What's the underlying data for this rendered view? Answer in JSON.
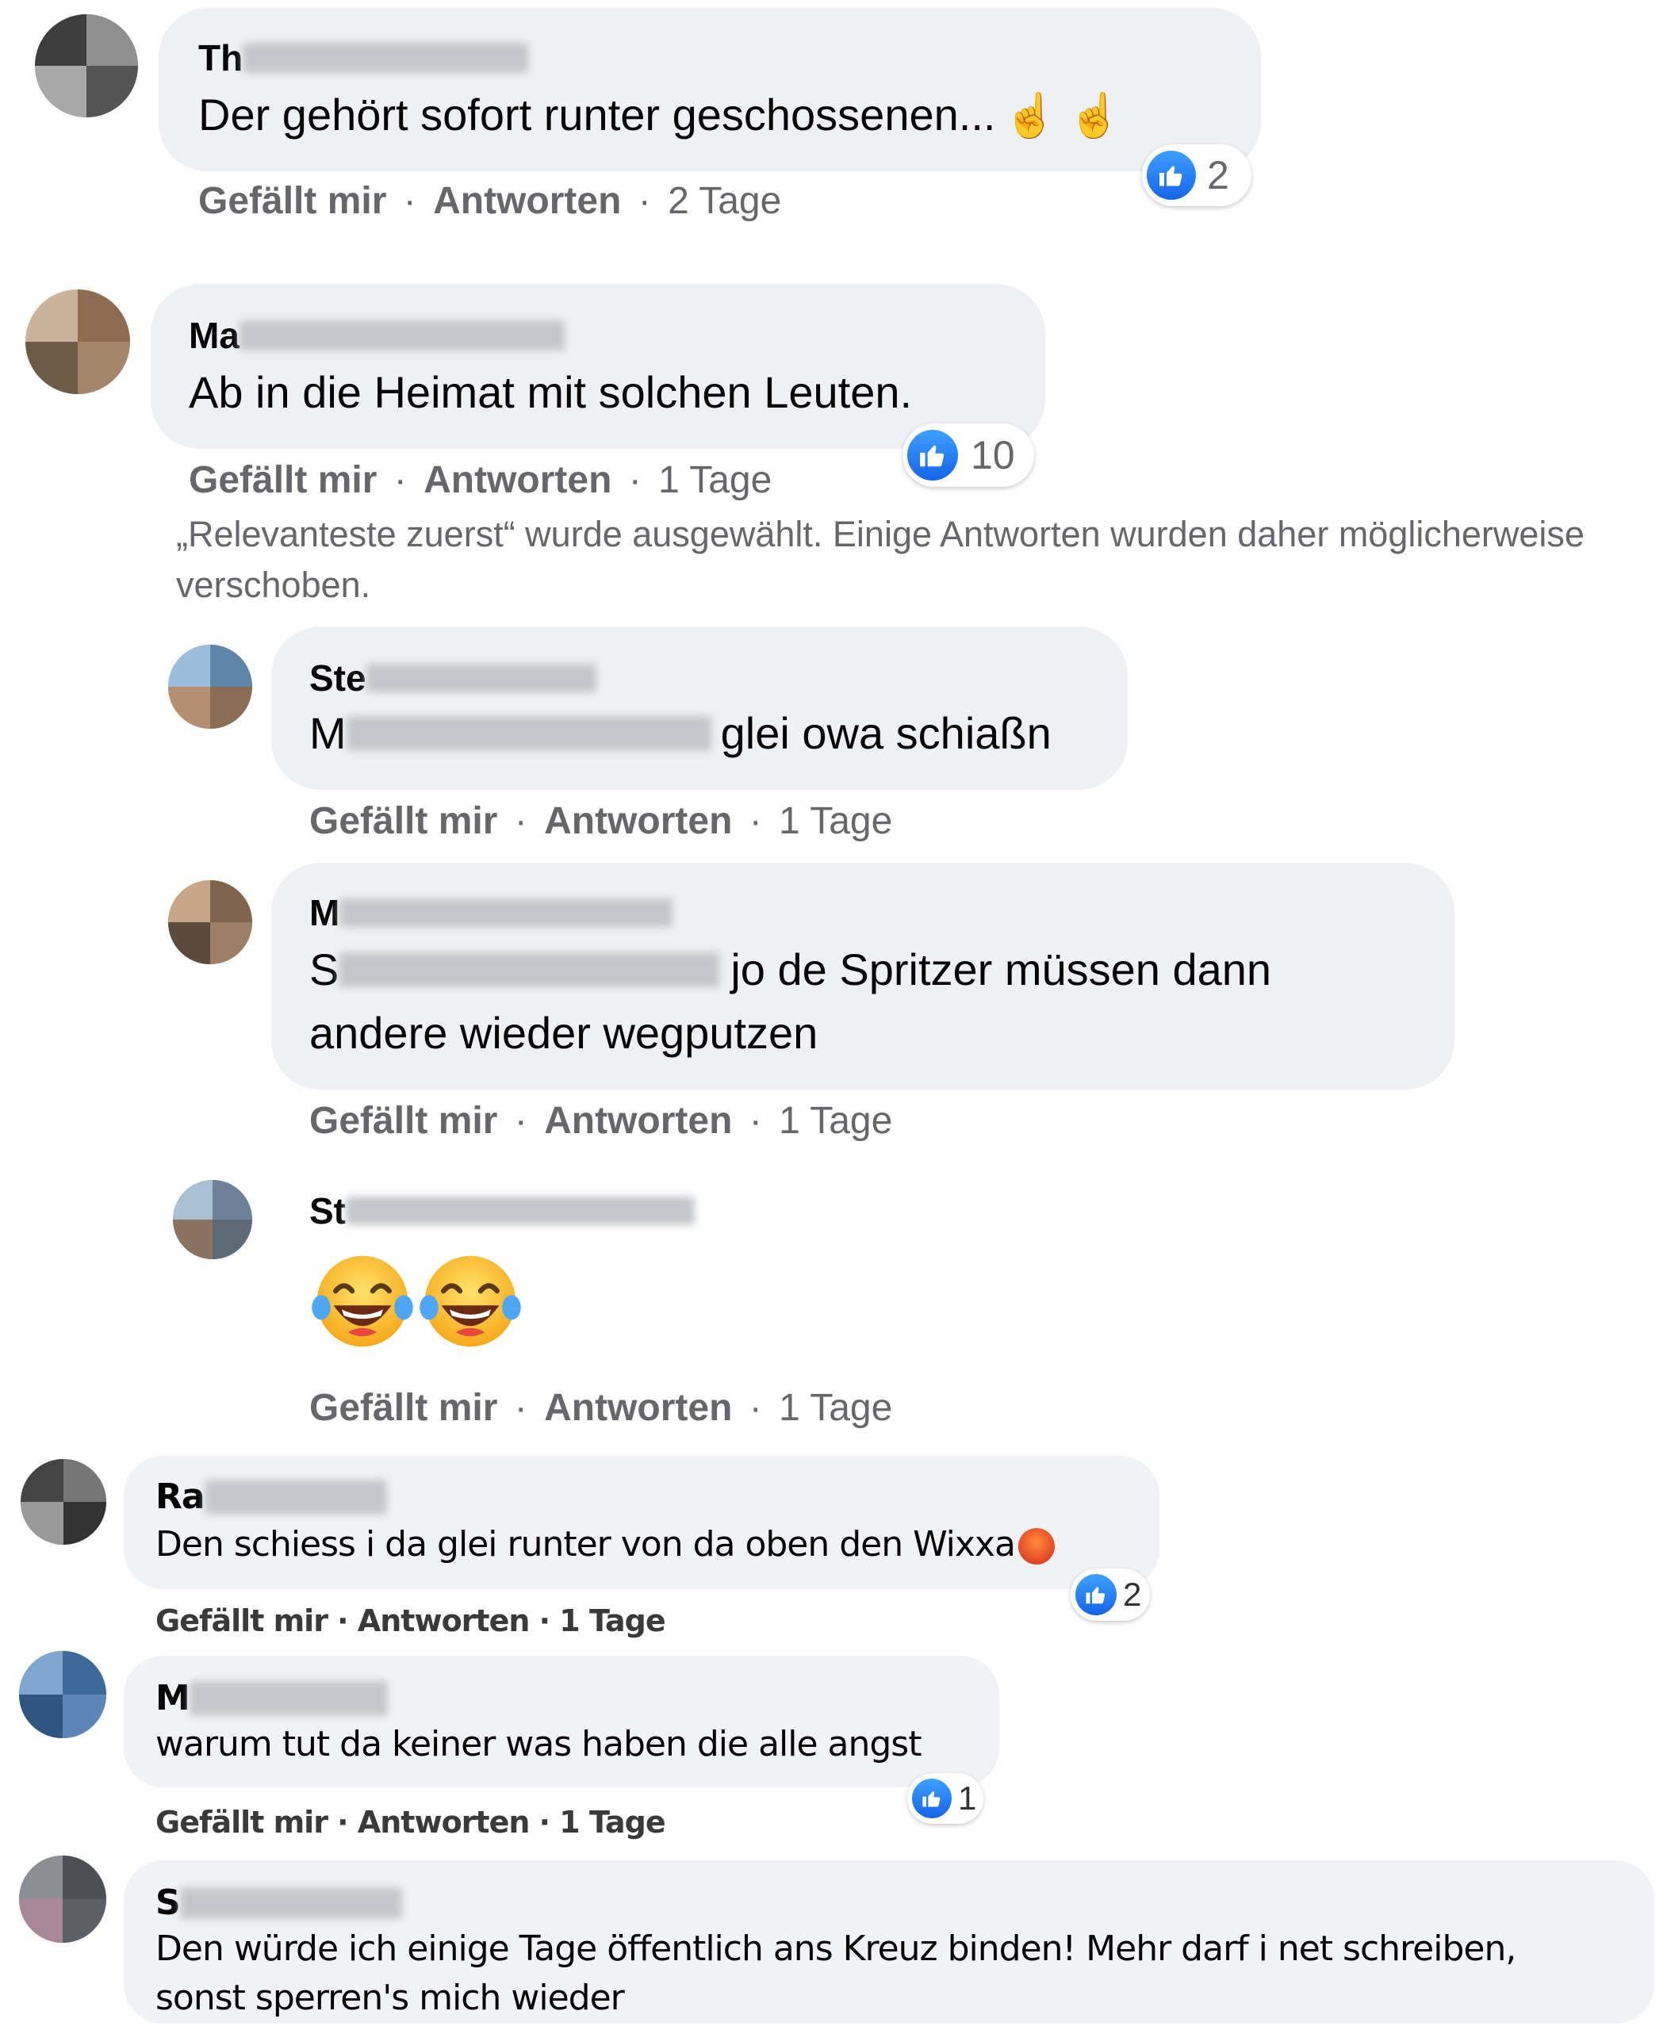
{
  "comments": [
    {
      "name_visible": "Th",
      "text": "Der gehört sofort runter geschossenen...",
      "emoji": "☝☝",
      "reaction_count": "2",
      "actions": {
        "like": "Gefällt mir",
        "sep": "·",
        "reply": "Antworten",
        "time": "2 Tage"
      }
    },
    {
      "name_visible": "Ma",
      "text": "Ab in die Heimat mit solchen Leuten.",
      "reaction_count": "10",
      "actions": {
        "like": "Gefällt mir",
        "sep": "·",
        "reply": "Antworten",
        "time": "1 Tage"
      }
    }
  ],
  "notice": "„Relevanteste zuerst“ wurde ausgewählt. Einige Antworten wurden daher möglicherweise verschoben.",
  "replies": [
    {
      "name_visible": "Ste",
      "mention_visible": "M",
      "text": "glei owa schiaßn",
      "actions": {
        "like": "Gefällt mir",
        "sep": "·",
        "reply": "Antworten",
        "time": "1 Tage"
      }
    },
    {
      "name_visible": "M",
      "mention_visible": "S",
      "text_line1": "jo de Spritzer müssen dann",
      "text_line2": "andere wieder wegputzen",
      "actions": {
        "like": "Gefällt mir",
        "sep": "·",
        "reply": "Antworten",
        "time": "1 Tage"
      }
    },
    {
      "name_visible": "St",
      "emoji_icon": "laughing-tears-icon",
      "actions": {
        "like": "Gefällt mir",
        "sep": "·",
        "reply": "Antworten",
        "time": "1 Tage"
      }
    }
  ],
  "scan_comments": [
    {
      "name_visible": "Ra",
      "text": "Den schiess i da glei runter von da oben den Wixxa",
      "reaction_count": "2",
      "actions": {
        "text": "Gefällt mir · Antworten · 1 Tage"
      }
    },
    {
      "name_visible": "M",
      "text": "warum tut da keiner was haben die alle angst",
      "reaction_count": "1",
      "actions": {
        "text": "Gefällt mir · Antworten · 1 Tage"
      }
    },
    {
      "name_visible": "S",
      "text_line1": "Den würde ich einige Tage öffentlich ans Kreuz binden! Mehr darf i net schreiben,",
      "text_line2": "sonst sperren's mich wieder"
    }
  ],
  "colors": {
    "bubble": "#eef0f3",
    "text": "#050505",
    "muted": "#65676b",
    "like_blue": "#1877f2"
  }
}
